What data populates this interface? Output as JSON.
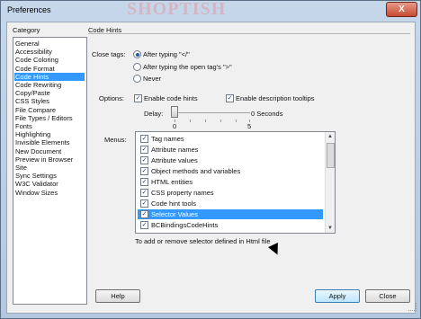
{
  "window": {
    "title": "Preferences",
    "watermark": "SHOPTISH",
    "close_glyph": "X"
  },
  "category": {
    "heading": "Category",
    "items": [
      {
        "label": "General"
      },
      {
        "label": "Accessibility"
      },
      {
        "label": "Code Coloring"
      },
      {
        "label": "Code Format"
      },
      {
        "label": "Code Hints",
        "selected": true
      },
      {
        "label": "Code Rewriting"
      },
      {
        "label": "Copy/Paste"
      },
      {
        "label": "CSS Styles"
      },
      {
        "label": "File Compare"
      },
      {
        "label": "File Types / Editors"
      },
      {
        "label": "Fonts"
      },
      {
        "label": "Highlighting"
      },
      {
        "label": "Invisible Elements"
      },
      {
        "label": "New Document"
      },
      {
        "label": "Preview in Browser"
      },
      {
        "label": "Site"
      },
      {
        "label": "Sync Settings"
      },
      {
        "label": "W3C Validator"
      },
      {
        "label": "Window Sizes"
      }
    ]
  },
  "panel": {
    "title": "Code Hints",
    "close_tags": {
      "label": "Close tags:",
      "options": [
        {
          "label": "After typing \"</\"",
          "checked": true
        },
        {
          "label": "After typing the open tag's \">\"",
          "checked": false
        },
        {
          "label": "Never",
          "checked": false
        }
      ]
    },
    "options": {
      "label": "Options:",
      "enable_code_hints": "Enable code hints",
      "enable_description_tooltips": "Enable description tooltips",
      "checkmark": "✓"
    },
    "delay": {
      "label": "Delay:",
      "value_text": "0 Seconds",
      "min_label": "0",
      "max_label": "5",
      "value": 0
    },
    "menus": {
      "label": "Menus:",
      "items": [
        {
          "label": "Tag names",
          "checked": true
        },
        {
          "label": "Attribute names",
          "checked": true
        },
        {
          "label": "Attribute values",
          "checked": true
        },
        {
          "label": "Object methods and variables",
          "checked": true
        },
        {
          "label": "HTML entities",
          "checked": true
        },
        {
          "label": "CSS property names",
          "checked": true
        },
        {
          "label": "Code hint tools",
          "checked": true
        },
        {
          "label": "Selector Values",
          "checked": true,
          "selected": true
        },
        {
          "label": "BCBindingsCodeHints",
          "checked": true
        }
      ],
      "description": "To add or remove selector defined in Html file",
      "scroll_up": "▲",
      "scroll_down": "▼"
    }
  },
  "buttons": {
    "help": "Help",
    "apply": "Apply",
    "close": "Close"
  }
}
